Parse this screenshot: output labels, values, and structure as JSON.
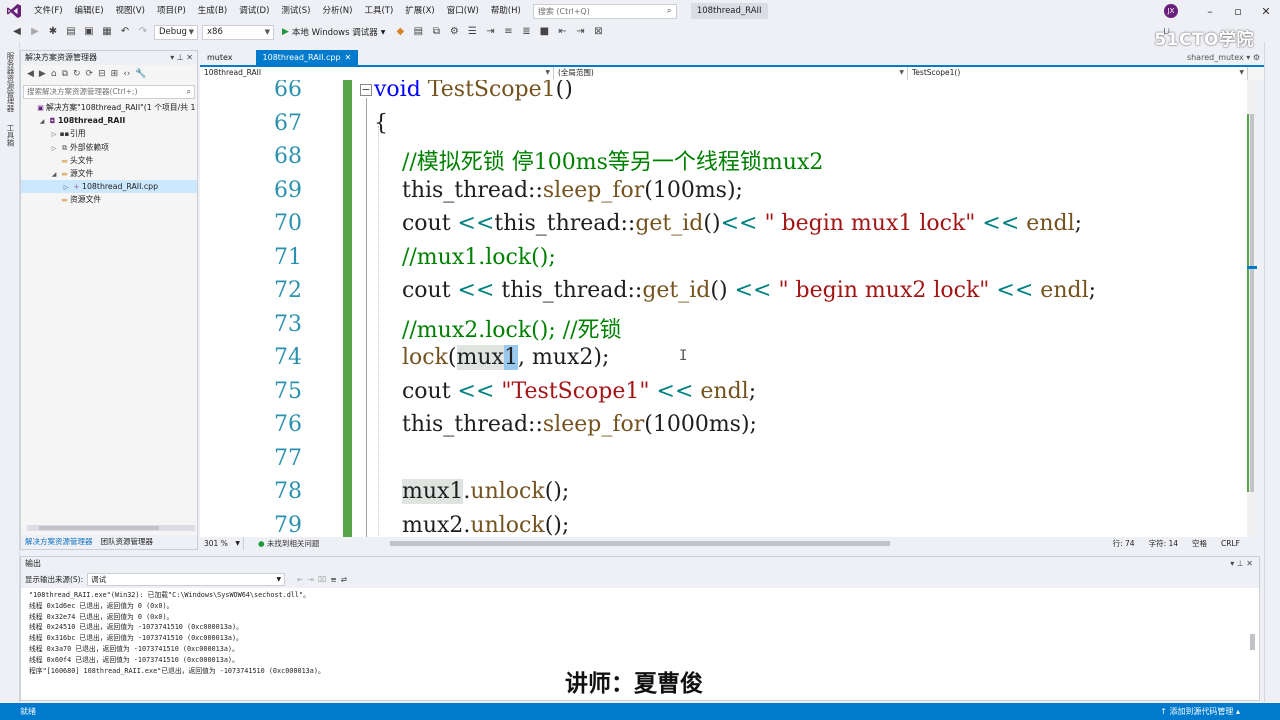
{
  "menubar": {
    "items": [
      "文件(F)",
      "编辑(E)",
      "视图(V)",
      "项目(P)",
      "生成(B)",
      "调试(D)",
      "测试(S)",
      "分析(N)",
      "工具(T)",
      "扩展(X)",
      "窗口(W)",
      "帮助(H)"
    ],
    "search_placeholder": "搜索 (Ctrl+Q)",
    "solution_name": "108thread_RAII",
    "avatar": "JX"
  },
  "toolbar": {
    "config": "Debug",
    "platform": "x86",
    "run_label": "本地 Windows 调试器",
    "share_label": "Li"
  },
  "brand": "51CTO学院",
  "left_strip": [
    "服务器资源管理器",
    "工具箱"
  ],
  "solution_explorer": {
    "title": "解决方案资源管理器",
    "search_placeholder": "搜索解决方案资源管理器(Ctrl+;)",
    "tree": [
      {
        "label": "解决方案\"108thread_RAII\"(1 个项目/共 1",
        "indent": 0,
        "exp": "",
        "icon": "sln"
      },
      {
        "label": "108thread_RAII",
        "indent": 1,
        "exp": "◢",
        "icon": "proj",
        "bold": true
      },
      {
        "label": "引用",
        "indent": 2,
        "exp": "▷",
        "icon": "ref"
      },
      {
        "label": "外部依赖项",
        "indent": 2,
        "exp": "▷",
        "icon": "ext"
      },
      {
        "label": "头文件",
        "indent": 2,
        "exp": "",
        "icon": "folder"
      },
      {
        "label": "源文件",
        "indent": 2,
        "exp": "◢",
        "icon": "folder"
      },
      {
        "label": "108thread_RAII.cpp",
        "indent": 3,
        "exp": "▷",
        "icon": "cpp",
        "selected": true
      },
      {
        "label": "资源文件",
        "indent": 2,
        "exp": "",
        "icon": "folder"
      }
    ],
    "tabs": [
      "解决方案资源管理器",
      "团队资源管理器"
    ]
  },
  "editor": {
    "tabs": [
      {
        "label": "mutex",
        "active": false
      },
      {
        "label": "108thread_RAII.cpp",
        "active": true
      }
    ],
    "right_tab": "shared_mutex",
    "nav": [
      "108thread_RAII",
      "(全局范围)",
      "TestScope1()"
    ],
    "lines": [
      {
        "num": "66",
        "tokens": [
          {
            "t": "void",
            "c": "kw"
          },
          {
            "t": " "
          },
          {
            "t": "TestScope1",
            "c": "fn"
          },
          {
            "t": "()"
          }
        ]
      },
      {
        "num": "67",
        "tokens": [
          {
            "t": "{"
          }
        ]
      },
      {
        "num": "68",
        "tokens": [
          {
            "t": "    //模拟死锁 停100ms等另一个线程锁mux2",
            "c": "cm"
          }
        ]
      },
      {
        "num": "69",
        "tokens": [
          {
            "t": "    this_thread::"
          },
          {
            "t": "sleep_for",
            "c": "fn"
          },
          {
            "t": "(100ms);"
          }
        ]
      },
      {
        "num": "70",
        "tokens": [
          {
            "t": "    cout "
          },
          {
            "t": "<<",
            "c": "op"
          },
          {
            "t": "this_thread::"
          },
          {
            "t": "get_id",
            "c": "fn"
          },
          {
            "t": "()"
          },
          {
            "t": "<<",
            "c": "op"
          },
          {
            "t": " "
          },
          {
            "t": "\" begin mux1 lock\"",
            "c": "st"
          },
          {
            "t": " "
          },
          {
            "t": "<<",
            "c": "op"
          },
          {
            "t": " "
          },
          {
            "t": "endl",
            "c": "fn"
          },
          {
            "t": ";"
          }
        ]
      },
      {
        "num": "71",
        "tokens": [
          {
            "t": "    //mux1.lock();",
            "c": "cm"
          }
        ]
      },
      {
        "num": "72",
        "tokens": [
          {
            "t": "    cout "
          },
          {
            "t": "<<",
            "c": "op"
          },
          {
            "t": " this_thread::"
          },
          {
            "t": "get_id",
            "c": "fn"
          },
          {
            "t": "() "
          },
          {
            "t": "<<",
            "c": "op"
          },
          {
            "t": " "
          },
          {
            "t": "\" begin mux2 lock\"",
            "c": "st"
          },
          {
            "t": " "
          },
          {
            "t": "<<",
            "c": "op"
          },
          {
            "t": " "
          },
          {
            "t": "endl",
            "c": "fn"
          },
          {
            "t": ";"
          }
        ]
      },
      {
        "num": "73",
        "tokens": [
          {
            "t": "    //mux2.lock(); //死锁",
            "c": "cm"
          }
        ]
      },
      {
        "num": "74",
        "tokens": [
          {
            "t": "    "
          },
          {
            "t": "lock",
            "c": "fn"
          },
          {
            "t": "("
          },
          {
            "t": "mux",
            "c": "hl"
          },
          {
            "t": "1",
            "c": "caret-sel"
          },
          {
            "t": ", mux2);"
          }
        ]
      },
      {
        "num": "75",
        "tokens": [
          {
            "t": "    cout "
          },
          {
            "t": "<<",
            "c": "op"
          },
          {
            "t": " "
          },
          {
            "t": "\"TestScope1\"",
            "c": "st"
          },
          {
            "t": " "
          },
          {
            "t": "<<",
            "c": "op"
          },
          {
            "t": " "
          },
          {
            "t": "endl",
            "c": "fn"
          },
          {
            "t": ";"
          }
        ]
      },
      {
        "num": "76",
        "tokens": [
          {
            "t": "    this_thread::"
          },
          {
            "t": "sleep_for",
            "c": "fn"
          },
          {
            "t": "(1000ms);"
          }
        ]
      },
      {
        "num": "77",
        "tokens": [
          {
            "t": ""
          }
        ]
      },
      {
        "num": "78",
        "tokens": [
          {
            "t": "    "
          },
          {
            "t": "mux1",
            "c": "hl"
          },
          {
            "t": "."
          },
          {
            "t": "unlock",
            "c": "fn"
          },
          {
            "t": "();"
          }
        ]
      },
      {
        "num": "79",
        "tokens": [
          {
            "t": "    mux2."
          },
          {
            "t": "unlock",
            "c": "fn"
          },
          {
            "t": "();"
          }
        ]
      }
    ]
  },
  "edit_status": {
    "zoom": "301 %",
    "issues": "未找到相关问题",
    "row": "行: 74",
    "col": "字符: 14",
    "ws": "空格",
    "eol": "CRLF"
  },
  "output": {
    "title": "输出",
    "source_label": "显示输出来源(S):",
    "source_value": "调试",
    "lines": [
      "\"108thread_RAII.exe\"(Win32): 已加载\"C:\\Windows\\SysWOW64\\sechost.dll\"。",
      "线程 0x1d6ec 已退出，返回值为 0 (0x0)。",
      "线程 0x32e74 已退出，返回值为 0 (0x0)。",
      "线程 0x24510 已退出，返回值为 -1073741510 (0xc000013a)。",
      "线程 0x316bc 已退出，返回值为 -1073741510 (0xc000013a)。",
      "线程 0x3a70 已退出，返回值为 -1073741510 (0xc000013a)。",
      "线程 0x60f4 已退出，返回值为 -1073741510 (0xc000013a)。",
      "程序\"[160680] 108thread_RAII.exe\"已退出，返回值为 -1073741510 (0xc000013a)。"
    ]
  },
  "lecturer": "讲师：夏曹俊",
  "statusbar": {
    "left": "就绪",
    "right": "添加到源代码管理"
  }
}
